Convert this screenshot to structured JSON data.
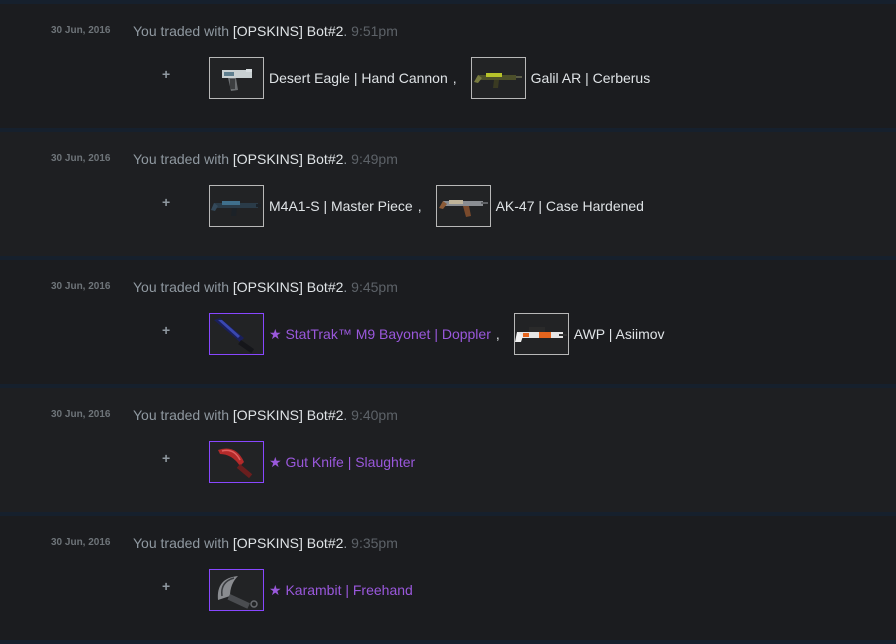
{
  "rows": [
    {
      "date": "30 Jun, 2016",
      "prefix": "You traded with ",
      "partner": "[OPSKINS] Bot#2",
      "sep": ". ",
      "time": "9:51pm",
      "plus": "+",
      "items": [
        {
          "name": "Desert Eagle | Hand Cannon",
          "suffix": ",",
          "rarity": "normal",
          "icon": "desert-eagle-icon"
        },
        {
          "name": "Galil AR | Cerberus",
          "suffix": "",
          "rarity": "normal",
          "icon": "galil-ar-icon"
        }
      ]
    },
    {
      "date": "30 Jun, 2016",
      "prefix": "You traded with ",
      "partner": "[OPSKINS] Bot#2",
      "sep": ". ",
      "time": "9:49pm",
      "plus": "+",
      "items": [
        {
          "name": "M4A1-S | Master Piece",
          "suffix": ",",
          "rarity": "normal",
          "icon": "m4a1-s-icon"
        },
        {
          "name": "AK-47 | Case Hardened",
          "suffix": "",
          "rarity": "normal",
          "icon": "ak-47-icon"
        }
      ]
    },
    {
      "date": "30 Jun, 2016",
      "prefix": "You traded with ",
      "partner": "[OPSKINS] Bot#2",
      "sep": ". ",
      "time": "9:45pm",
      "plus": "+",
      "items": [
        {
          "name": "★ StatTrak™ M9 Bayonet | Doppler",
          "suffix": ",",
          "rarity": "purple",
          "icon": "m9-bayonet-icon"
        },
        {
          "name": "AWP | Asiimov",
          "suffix": "",
          "rarity": "normal",
          "icon": "awp-icon"
        }
      ]
    },
    {
      "date": "30 Jun, 2016",
      "prefix": "You traded with ",
      "partner": "[OPSKINS] Bot#2",
      "sep": ". ",
      "time": "9:40pm",
      "plus": "+",
      "items": [
        {
          "name": "★ Gut Knife | Slaughter",
          "suffix": "",
          "rarity": "purple",
          "icon": "gut-knife-icon"
        }
      ]
    },
    {
      "date": "30 Jun, 2016",
      "prefix": "You traded with ",
      "partner": "[OPSKINS] Bot#2",
      "sep": ". ",
      "time": "9:35pm",
      "plus": "+",
      "items": [
        {
          "name": "★ Karambit | Freehand",
          "suffix": "",
          "rarity": "purple",
          "icon": "karambit-icon"
        }
      ]
    }
  ]
}
